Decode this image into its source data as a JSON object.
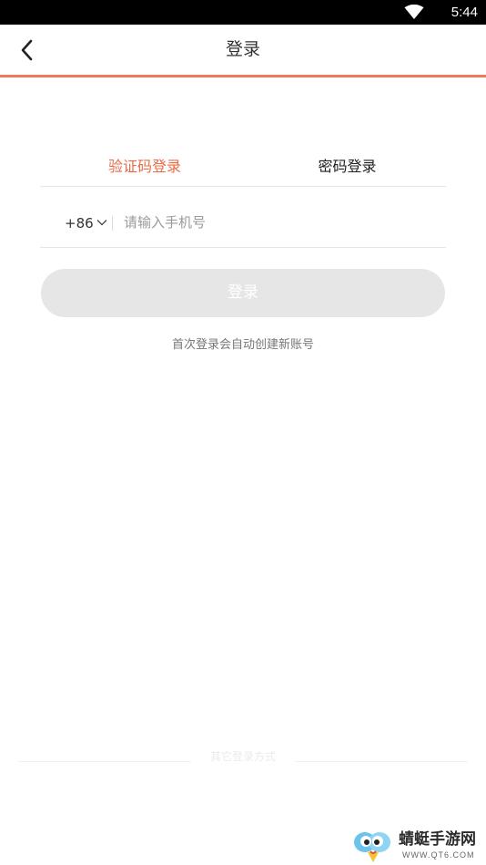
{
  "status_bar": {
    "time": "5:44",
    "wifi_icon": "wifi-icon"
  },
  "header": {
    "title": "登录",
    "back_icon": "chevron-left-icon"
  },
  "tabs": [
    {
      "label": "验证码登录",
      "active": true
    },
    {
      "label": "密码登录",
      "active": false
    }
  ],
  "phone": {
    "country_code": "+86",
    "country_dropdown_icon": "chevron-down-icon",
    "placeholder": "请输入手机号",
    "value": ""
  },
  "login_button": {
    "label": "登录",
    "enabled": false
  },
  "hint": "首次登录会自动创建新账号",
  "other_login": {
    "label": "其它登录方式"
  },
  "watermark": {
    "name": "蜻蜓手游网",
    "url": "WWW.QT6.COM"
  },
  "colors": {
    "accent": "#e96b47",
    "accent_line": "#ec7a57",
    "button_disabled": "#e6e6e6",
    "status_bar": "#000000"
  }
}
